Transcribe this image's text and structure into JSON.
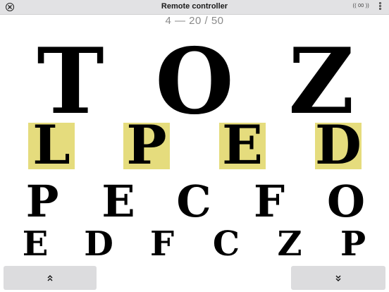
{
  "window": {
    "title": "Remote controller",
    "status": "(( 00 ))"
  },
  "chart": {
    "level_text": "4 — 20 / 50",
    "rows": [
      {
        "letters": [
          "T",
          "O",
          "Z"
        ],
        "highlighted": false
      },
      {
        "letters": [
          "L",
          "P",
          "E",
          "D"
        ],
        "highlighted": true
      },
      {
        "letters": [
          "P",
          "E",
          "C",
          "F",
          "O"
        ],
        "highlighted": false
      },
      {
        "letters": [
          "E",
          "D",
          "F",
          "C",
          "Z",
          "P"
        ],
        "highlighted": false
      }
    ],
    "highlight_color": "#e5dc7d"
  },
  "buttons": {
    "prev_icon": "double-chevron-up-icon",
    "next_icon": "double-chevron-down-icon"
  }
}
